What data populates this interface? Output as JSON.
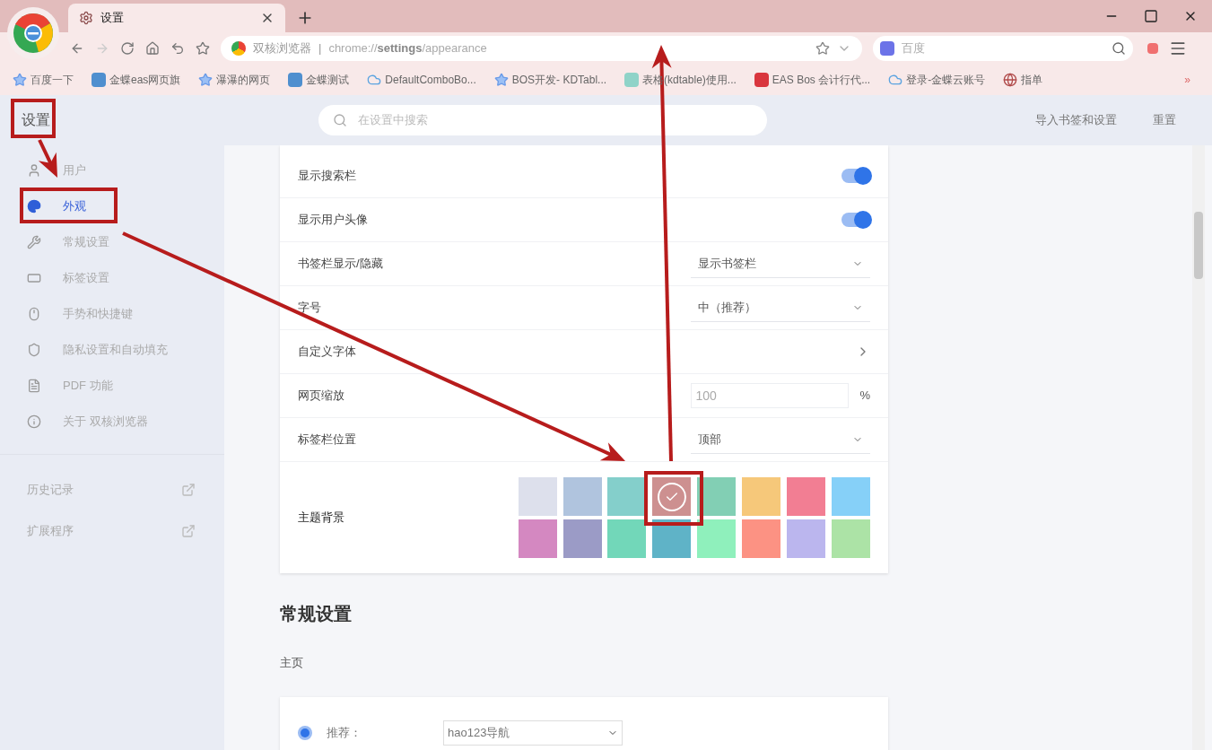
{
  "tab": {
    "title": "设置"
  },
  "address_bar": {
    "site": "双核浏览器",
    "separator": "|",
    "url_prefix": "chrome://",
    "url_bold": "settings",
    "url_suffix": "/appearance"
  },
  "search_box": {
    "engine": "百度"
  },
  "bookmarks": [
    {
      "label": "百度一下"
    },
    {
      "label": "金蝶eas网页旗"
    },
    {
      "label": "瀑瀑的网页"
    },
    {
      "label": "金蝶测试"
    },
    {
      "label": "DefaultComboBo..."
    },
    {
      "label": "BOS开发- KDTabl..."
    },
    {
      "label": "表格(kdtable)使用..."
    },
    {
      "label": "EAS Bos 会计行代..."
    },
    {
      "label": "登录-金蝶云账号"
    },
    {
      "label": "指单"
    }
  ],
  "bookmarks_more": "»",
  "settings_header": {
    "title": "设置",
    "search_placeholder": "在设置中搜索",
    "actions": [
      "导入书签和设置",
      "重置"
    ]
  },
  "sidebar": {
    "items": [
      {
        "label": "用户",
        "selected": false
      },
      {
        "label": "外观",
        "selected": true
      },
      {
        "label": "常规设置",
        "selected": false
      },
      {
        "label": "标签设置",
        "selected": false
      },
      {
        "label": "手势和快捷键",
        "selected": false
      },
      {
        "label": "隐私设置和自动填充",
        "selected": false
      },
      {
        "label": "PDF 功能",
        "selected": false
      },
      {
        "label": "关于 双核浏览器",
        "selected": false
      }
    ],
    "links": [
      {
        "label": "历史记录"
      },
      {
        "label": "扩展程序"
      }
    ]
  },
  "appearance": {
    "rows": [
      {
        "kind": "toggle",
        "label": "显示搜索栏",
        "on": true
      },
      {
        "kind": "toggle",
        "label": "显示用户头像",
        "on": true
      },
      {
        "kind": "select",
        "label": "书签栏显示/隐藏",
        "value": "显示书签栏"
      },
      {
        "kind": "select",
        "label": "字号",
        "value": "中（推荐）"
      },
      {
        "kind": "link",
        "label": "自定义字体"
      },
      {
        "kind": "number",
        "label": "网页缩放",
        "placeholder": "100",
        "unit": "%"
      },
      {
        "kind": "select",
        "label": "标签栏位置",
        "value": "顶部"
      }
    ],
    "theme": {
      "label": "主题背景",
      "swatches": [
        {
          "color": "#dde0ec",
          "selected": false
        },
        {
          "color": "#b0c4de",
          "selected": false
        },
        {
          "color": "#84cfcb",
          "selected": false
        },
        {
          "color": "#cd9090",
          "selected": true
        },
        {
          "color": "#82cfb4",
          "selected": false
        },
        {
          "color": "#f6c87a",
          "selected": false
        },
        {
          "color": "#f27e93",
          "selected": false
        },
        {
          "color": "#86d0f8",
          "selected": false
        },
        {
          "color": "#d488c1",
          "selected": false
        },
        {
          "color": "#9b9bc6",
          "selected": false
        },
        {
          "color": "#72d7b9",
          "selected": false
        },
        {
          "color": "#5fb3c7",
          "selected": false
        },
        {
          "color": "#8ff0bc",
          "selected": false
        },
        {
          "color": "#fc9283",
          "selected": false
        },
        {
          "color": "#bbb6ee",
          "selected": false
        },
        {
          "color": "#ace3a6",
          "selected": false
        }
      ]
    }
  },
  "general": {
    "title": "常规设置",
    "subtitle": "主页",
    "option": {
      "label": "推荐：",
      "selected": true,
      "value": "hao123导航"
    }
  }
}
